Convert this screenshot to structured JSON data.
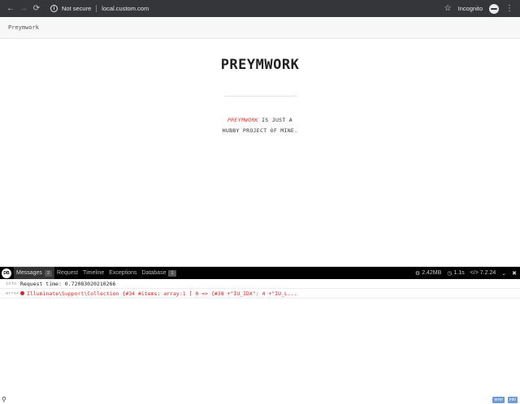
{
  "browser": {
    "back_icon": "←",
    "forward_icon": "→",
    "reload_icon": "⟳",
    "security_label": "Not secure",
    "url": "local.custom.com",
    "star_icon": "☆",
    "incognito_label": "Incognito",
    "menu_icon": "⋮"
  },
  "header": {
    "title": "Preymwork"
  },
  "main": {
    "brand": "PREYMWORK",
    "tagline_accent": "PREYMWORK",
    "tagline_rest1": " IS JUST A",
    "tagline_line2": "HUBBY PROJECT OF MINE."
  },
  "debugbar": {
    "tabs": [
      {
        "label": "Messages",
        "badge": "2"
      },
      {
        "label": "Request"
      },
      {
        "label": "Timeline"
      },
      {
        "label": "Exceptions"
      },
      {
        "label": "Database",
        "badge": "1"
      }
    ],
    "memory": "2.42MB",
    "time": "1.1s",
    "php_version": "7.2.24",
    "messages": [
      {
        "level": "info",
        "text": "Request time: 0.72083020210266"
      },
      {
        "level": "error",
        "text": "Illuminate\\Support\\Collection {#34 #items: array:1 [ 0 => {#38 +\"IU_IDX\": 4 +\"IU_L..."
      }
    ],
    "filters": [
      "error",
      "info"
    ]
  },
  "colors": {
    "accent": "#e3342f",
    "chrome_bg": "#35363a",
    "debugbar_bg": "#000000"
  }
}
